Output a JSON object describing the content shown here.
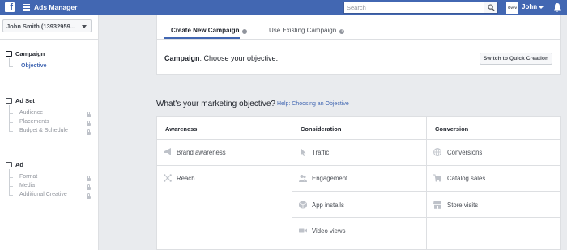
{
  "topbar": {
    "logo": "f",
    "app_title": "Ads Manager",
    "search_placeholder": "Search",
    "avatar_text": "Ovvv",
    "user_name": "John"
  },
  "sidebar": {
    "account": "John Smith (13932959...",
    "campaign": {
      "title": "Campaign",
      "steps": [
        {
          "label": "Objective",
          "active": true
        }
      ]
    },
    "adset": {
      "title": "Ad Set",
      "steps": [
        {
          "label": "Audience",
          "locked": true
        },
        {
          "label": "Placements",
          "locked": true
        },
        {
          "label": "Budget & Schedule",
          "locked": true
        }
      ]
    },
    "ad": {
      "title": "Ad",
      "steps": [
        {
          "label": "Format",
          "locked": true
        },
        {
          "label": "Media",
          "locked": true
        },
        {
          "label": "Additional Creative",
          "locked": true
        }
      ]
    }
  },
  "main": {
    "tabs": [
      {
        "label": "Create New Campaign",
        "active": true
      },
      {
        "label": "Use Existing Campaign",
        "active": false
      }
    ],
    "campaign_label": "Campaign",
    "campaign_text": ": Choose your objective.",
    "quick_creation_label": "Switch to Quick Creation",
    "objective_question": "What's your marketing objective?",
    "help_link": "Help: Choosing an Objective",
    "columns": [
      {
        "title": "Awareness",
        "items": [
          {
            "label": "Brand awareness",
            "icon": "megaphone-icon"
          },
          {
            "label": "Reach",
            "icon": "snowflake-icon"
          }
        ]
      },
      {
        "title": "Consideration",
        "items": [
          {
            "label": "Traffic",
            "icon": "cursor-icon"
          },
          {
            "label": "Engagement",
            "icon": "people-icon"
          },
          {
            "label": "App installs",
            "icon": "box-icon"
          },
          {
            "label": "Video views",
            "icon": "video-camera-icon"
          }
        ]
      },
      {
        "title": "Conversion",
        "items": [
          {
            "label": "Conversions",
            "icon": "globe-icon"
          },
          {
            "label": "Catalog sales",
            "icon": "cart-icon"
          },
          {
            "label": "Store visits",
            "icon": "store-icon"
          }
        ]
      }
    ]
  },
  "colors": {
    "brand": "#4267b2",
    "icon_gray": "#bec2c9",
    "background": "#e9ebee"
  }
}
